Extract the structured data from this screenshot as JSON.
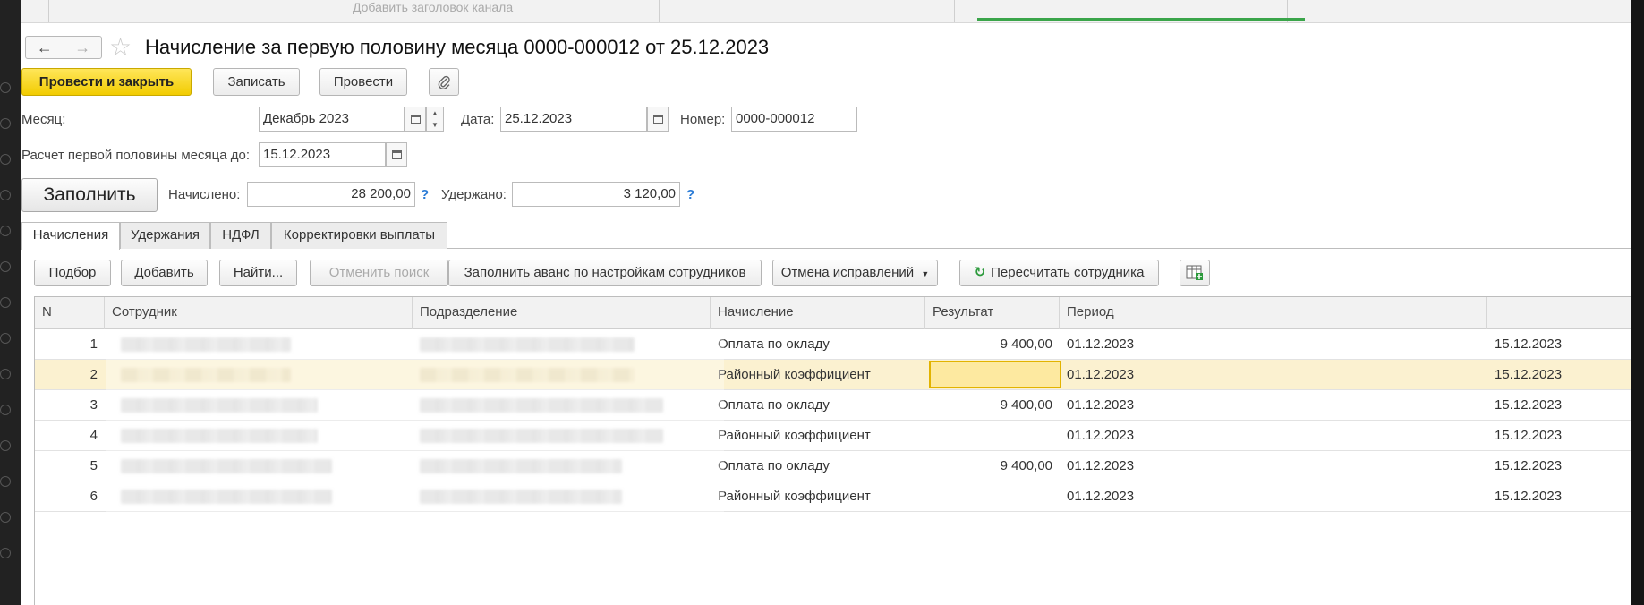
{
  "topbar": {
    "ghost_text": "Добавить заголовок канала"
  },
  "titlebar": {
    "back_icon": "arrow-left-icon",
    "forward_icon": "arrow-right-icon",
    "star_icon": "star-icon",
    "title": "Начисление за первую половину месяца 0000-000012 от 25.12.2023"
  },
  "toolbar": {
    "post_and_close": "Провести и закрыть",
    "save": "Записать",
    "post": "Провести",
    "attach_icon": "paperclip-icon"
  },
  "form": {
    "month_label": "Месяц:",
    "month_value": "Декабрь 2023",
    "date_label": "Дата:",
    "date_value": "25.12.2023",
    "number_label": "Номер:",
    "number_value": "0000-000012",
    "first_half_label": "Расчет первой половины месяца до:",
    "first_half_value": "15.12.2023",
    "fill_button": "Заполнить",
    "accrued_label": "Начислено:",
    "accrued_value": "28 200,00",
    "withheld_label": "Удержано:",
    "withheld_value": "3 120,00",
    "help_mark": "?"
  },
  "tabs": [
    {
      "label": "Начисления",
      "active": true
    },
    {
      "label": "Удержания",
      "active": false
    },
    {
      "label": "НДФЛ",
      "active": false
    },
    {
      "label": "Корректировки выплаты",
      "active": false
    }
  ],
  "table_toolbar": {
    "pick": "Подбор",
    "add": "Добавить",
    "find": "Найти...",
    "cancel_search": "Отменить поиск",
    "fill_advance": "Заполнить аванс по настройкам сотрудников",
    "cancel_corrections": "Отмена исправлений",
    "recalc_employee": "Пересчитать сотрудника",
    "refresh_icon": "refresh-icon",
    "dropdown_icon": "caret-down-icon",
    "table_settings_icon": "table-settings-icon"
  },
  "table": {
    "columns": [
      "N",
      "Сотрудник",
      "Подразделение",
      "Начисление",
      "Результат",
      "Период",
      ""
    ],
    "rows": [
      {
        "n": "1",
        "accrual": "Оплата по окладу",
        "result": "9 400,00",
        "period_from": "01.12.2023",
        "period_to": "15.12.2023",
        "selected": false
      },
      {
        "n": "2",
        "accrual": "Районный коэффициент",
        "result": "",
        "period_from": "01.12.2023",
        "period_to": "15.12.2023",
        "selected": true
      },
      {
        "n": "3",
        "accrual": "Оплата по окладу",
        "result": "9 400,00",
        "period_from": "01.12.2023",
        "period_to": "15.12.2023",
        "selected": false
      },
      {
        "n": "4",
        "accrual": "Районный коэффициент",
        "result": "",
        "period_from": "01.12.2023",
        "period_to": "15.12.2023",
        "selected": false
      },
      {
        "n": "5",
        "accrual": "Оплата по окладу",
        "result": "9 400,00",
        "period_from": "01.12.2023",
        "period_to": "15.12.2023",
        "selected": false
      },
      {
        "n": "6",
        "accrual": "Районный коэффициент",
        "result": "",
        "period_from": "01.12.2023",
        "period_to": "15.12.2023",
        "selected": false
      }
    ]
  },
  "colors": {
    "primary_button": "#f2cc00",
    "selected_row": "#fbf1d0",
    "help": "#2a7bd6",
    "active_strip": "#3aa54a"
  }
}
